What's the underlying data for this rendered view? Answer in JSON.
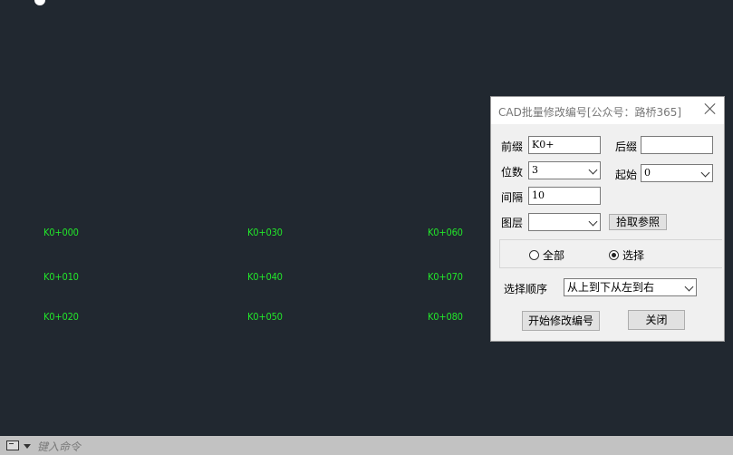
{
  "canvas": {
    "labels": [
      {
        "id": "k000",
        "text": "K0+000"
      },
      {
        "id": "k010",
        "text": "K0+010"
      },
      {
        "id": "k020",
        "text": "K0+020"
      },
      {
        "id": "k030",
        "text": "K0+030"
      },
      {
        "id": "k040",
        "text": "K0+040"
      },
      {
        "id": "k050",
        "text": "K0+050"
      },
      {
        "id": "k060",
        "text": "K0+060"
      },
      {
        "id": "k070",
        "text": "K0+070"
      },
      {
        "id": "k080",
        "text": "K0+080"
      }
    ]
  },
  "dialog": {
    "title": "CAD批量修改编号[公众号：路桥365]",
    "prefix_label": "前缀",
    "prefix_value": "K0+",
    "suffix_label": "后缀",
    "suffix_value": "",
    "digits_label": "位数",
    "digits_value": "3",
    "start_label": "起始",
    "start_value": "0",
    "interval_label": "间隔",
    "interval_value": "10",
    "layer_label": "图层",
    "layer_value": "",
    "pick_button": "拾取参照",
    "radio_all": "全部",
    "radio_select": "选择",
    "order_label": "选择顺序",
    "order_value": "从上到下从左到右",
    "start_button": "开始修改编号",
    "close_button": "关闭"
  },
  "command": {
    "placeholder": "键入命令"
  },
  "colors": {
    "canvas_bg": "#212830",
    "label_green": "#22e62a"
  }
}
